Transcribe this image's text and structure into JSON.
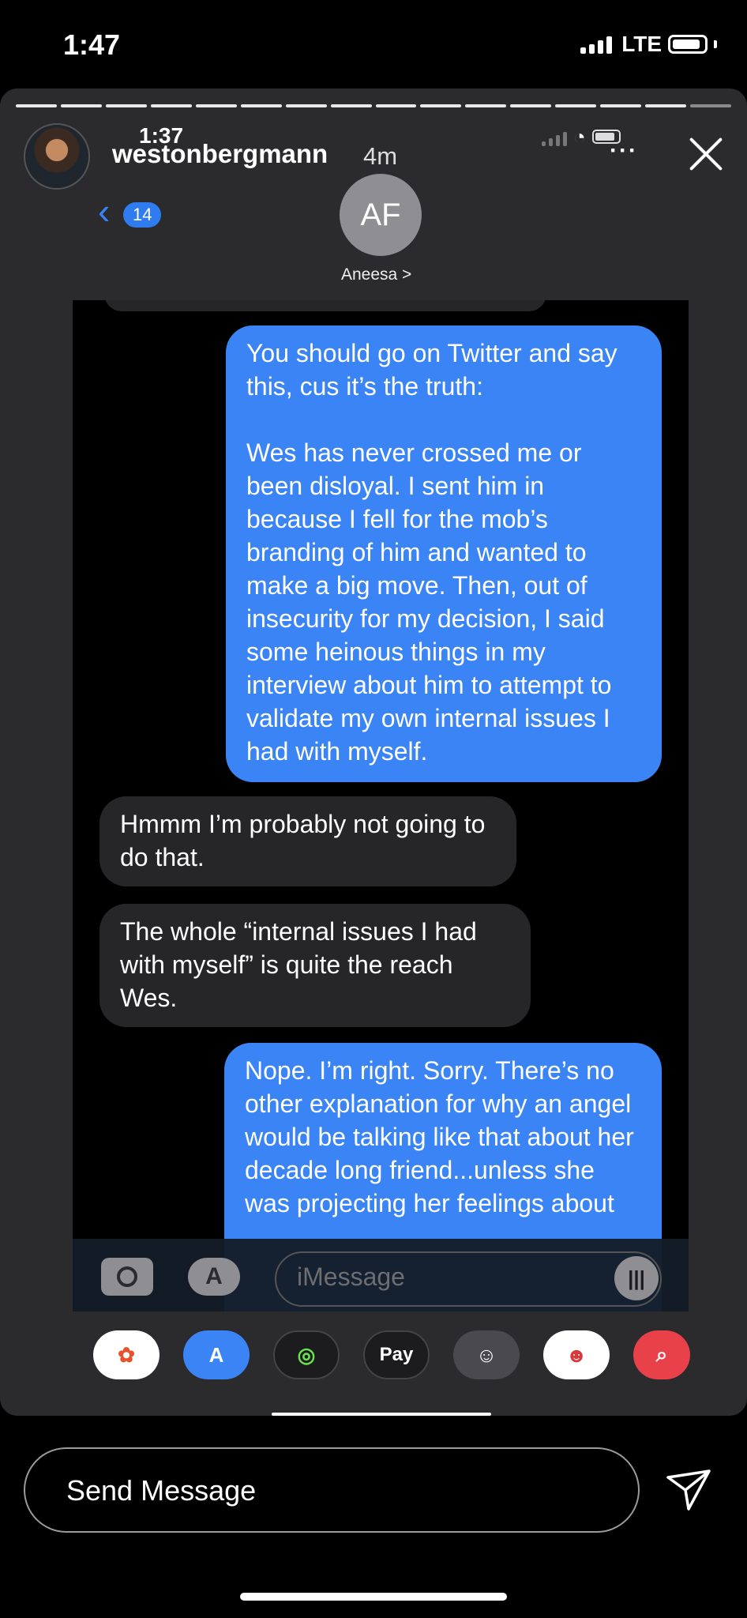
{
  "status_bar": {
    "time": "1:47",
    "network": "LTE"
  },
  "story": {
    "progress_segments": 16,
    "username": "westonbergmann",
    "age": "4m",
    "close_icon": "close-icon"
  },
  "inner_screenshot": {
    "status_time": "1:37",
    "back_count": "14",
    "contact_initials": "AF",
    "contact_name": "Aneesa >",
    "messages": [
      {
        "side": "sent",
        "text": "You should go on Twitter and say this, cus it’s the truth:\n\nWes has never crossed me or been disloyal. I sent him in because I fell for the mob’s branding of him and wanted to make a big move. Then, out of insecurity for my decision, I said some heinous things in my interview about him to attempt to validate my own internal issues I had with myself."
      },
      {
        "side": "received",
        "text": "Hmmm I’m probably not going to do that."
      },
      {
        "side": "received",
        "text": "The whole “internal issues I had with myself” is quite the reach Wes."
      },
      {
        "side": "sent",
        "text": "Nope. I’m right. Sorry. There’s no other explanation for why an angel would be talking like that about her decade long friend...unless she was projecting her feelings about"
      }
    ],
    "compose_placeholder": "iMessage",
    "app_tray": [
      "photos",
      "app-store",
      "activity",
      "Pay",
      "memoji",
      "animoji",
      "search"
    ]
  },
  "reply_bar": {
    "placeholder": "Send Message"
  },
  "colors": {
    "sent_bubble": "#3b84f5",
    "received_bubble": "#262628",
    "story_bg": "#2b2b2d"
  }
}
